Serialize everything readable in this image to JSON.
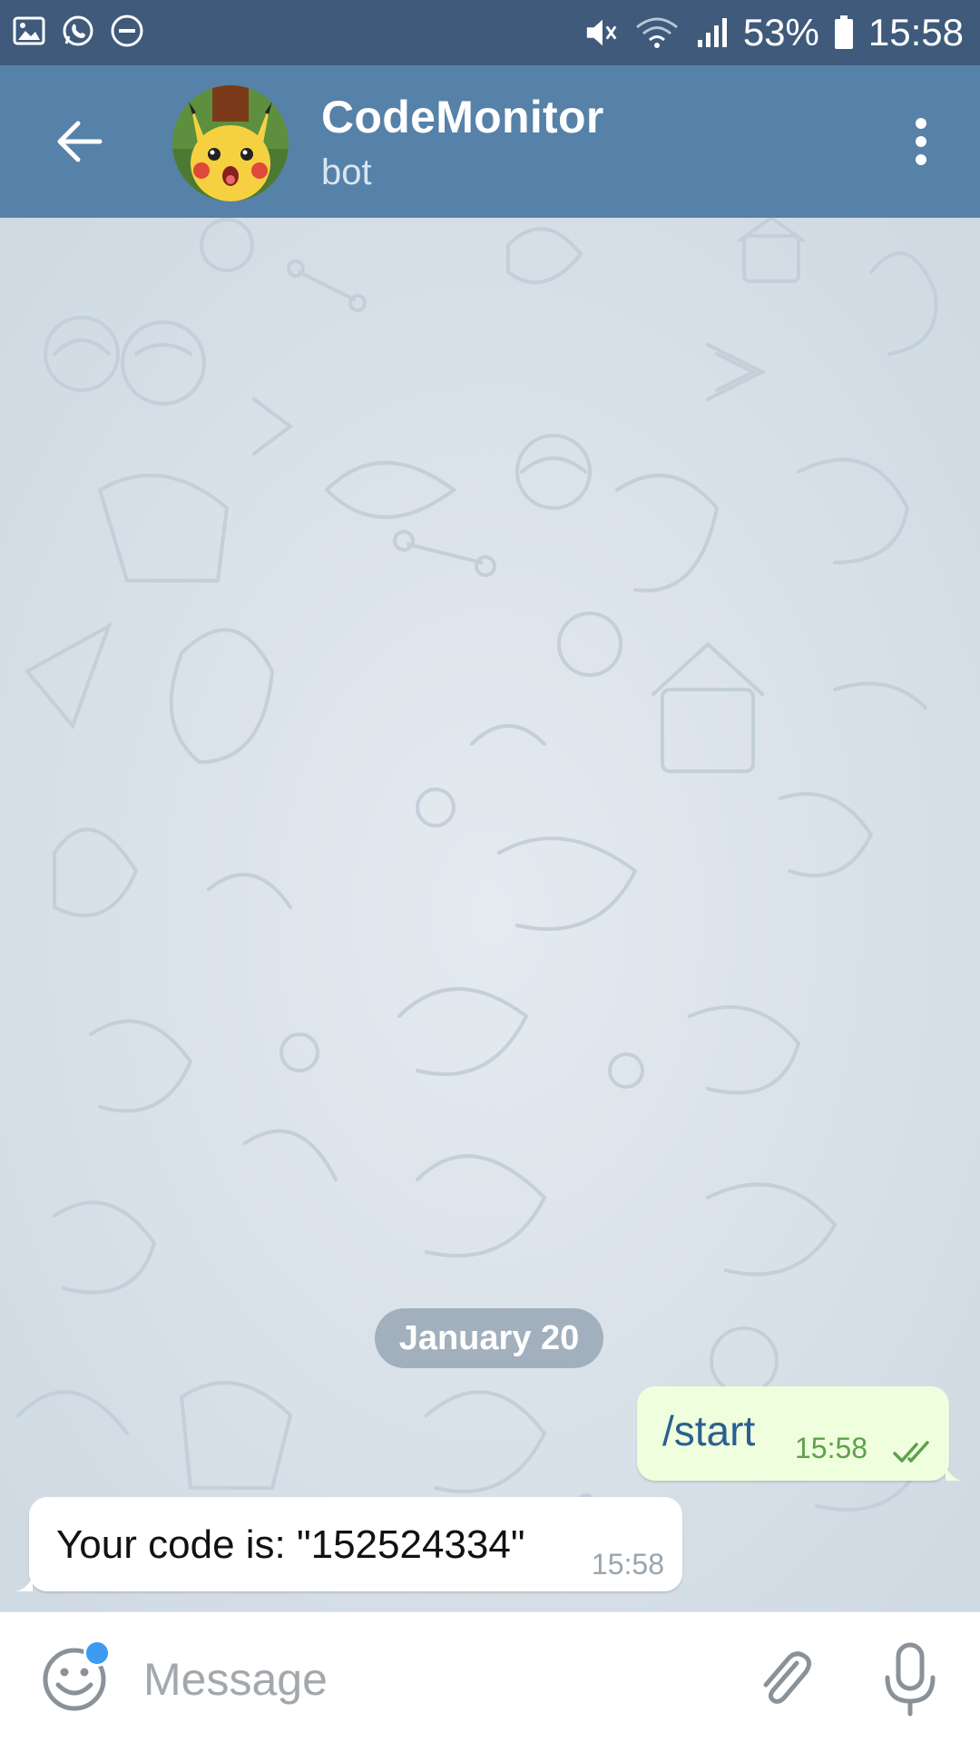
{
  "status_bar": {
    "icons_left": [
      "image-icon",
      "whatsapp-icon",
      "do-not-disturb-icon"
    ],
    "icons_right": [
      "mute-icon",
      "wifi-icon",
      "signal-icon"
    ],
    "battery": "53%",
    "time": "15:58"
  },
  "header": {
    "title": "CodeMonitor",
    "subtitle": "bot",
    "background_color": "#5681a8"
  },
  "chat": {
    "date_label": "January 20",
    "messages": [
      {
        "direction": "outgoing",
        "text": "/start",
        "time": "15:58",
        "status": "read"
      },
      {
        "direction": "incoming",
        "text": "Your code is: \"152524334\"",
        "time": "15:58"
      }
    ]
  },
  "input": {
    "placeholder": "Message"
  },
  "colors": {
    "status_bar": "#3f5a7a",
    "outgoing_bubble": "#effedd",
    "incoming_bubble": "#ffffff",
    "accent": "#3b9bf0"
  }
}
